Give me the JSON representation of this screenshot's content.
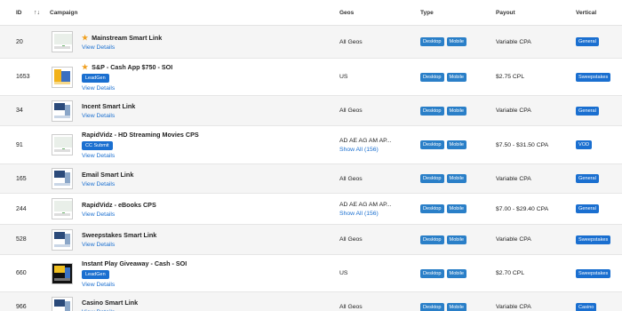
{
  "header": {
    "id": "ID",
    "sort_icon": "↑↓",
    "campaign": "Campaign",
    "geos": "Geos",
    "type": "Type",
    "payout": "Payout",
    "vertical": "Vertical"
  },
  "rows": [
    {
      "id": "20",
      "starred": true,
      "title": "Mainstream Smart Link",
      "tag": "",
      "link": "View Details",
      "geo": "All Geos",
      "geo_more": "",
      "types": [
        "Desktop",
        "Mobile"
      ],
      "payout": "Variable CPA",
      "vertical": "General",
      "thumb": "sheet"
    },
    {
      "id": "1653",
      "starred": true,
      "title": "S&P - Cash App $750 - SOI",
      "tag": "LeadGen",
      "link": "View Details",
      "geo": "US",
      "geo_more": "",
      "types": [
        "Desktop",
        "Mobile"
      ],
      "payout": "$2.75 CPL",
      "vertical": "Sweepstakes",
      "thumb": "promo"
    },
    {
      "id": "34",
      "starred": false,
      "title": "Incent Smart Link",
      "tag": "",
      "link": "View Details",
      "geo": "All Geos",
      "geo_more": "",
      "types": [
        "Desktop",
        "Mobile"
      ],
      "payout": "Variable CPA",
      "vertical": "General",
      "thumb": "std"
    },
    {
      "id": "91",
      "starred": false,
      "title": "RapidVidz - HD Streaming Movies CPS",
      "tag": "CC Submit",
      "link": "View Details",
      "geo": "AD AE AG AM AP...",
      "geo_more": "Show All (156)",
      "types": [
        "Desktop",
        "Mobile"
      ],
      "payout": "$7.50 - $31.50 CPA",
      "vertical": "VOD",
      "thumb": "sheet"
    },
    {
      "id": "165",
      "starred": false,
      "title": "Email Smart Link",
      "tag": "",
      "link": "View Details",
      "geo": "All Geos",
      "geo_more": "",
      "types": [
        "Desktop",
        "Mobile"
      ],
      "payout": "Variable CPA",
      "vertical": "General",
      "thumb": "std"
    },
    {
      "id": "244",
      "starred": false,
      "title": "RapidVidz - eBooks CPS",
      "tag": "",
      "link": "View Details",
      "geo": "AD AE AG AM AP...",
      "geo_more": "Show All (156)",
      "types": [
        "Desktop",
        "Mobile"
      ],
      "payout": "$7.00 - $29.40 CPA",
      "vertical": "General",
      "thumb": "sheet"
    },
    {
      "id": "528",
      "starred": false,
      "title": "Sweepstakes Smart Link",
      "tag": "",
      "link": "View Details",
      "geo": "All Geos",
      "geo_more": "",
      "types": [
        "Desktop",
        "Mobile"
      ],
      "payout": "Variable CPA",
      "vertical": "Sweepstakes",
      "thumb": "std"
    },
    {
      "id": "660",
      "starred": false,
      "title": "Instant Play Giveaway - Cash - SOI",
      "tag": "LeadGen",
      "link": "View Details",
      "geo": "US",
      "geo_more": "",
      "types": [
        "Desktop",
        "Mobile"
      ],
      "payout": "$2.70 CPL",
      "vertical": "Sweepstakes",
      "thumb": "dark"
    },
    {
      "id": "966",
      "starred": false,
      "title": "Casino Smart Link",
      "tag": "",
      "link": "View Details",
      "geo": "All Geos",
      "geo_more": "",
      "types": [
        "Desktop",
        "Mobile"
      ],
      "payout": "Variable CPA",
      "vertical": "Casino",
      "thumb": "std"
    }
  ]
}
